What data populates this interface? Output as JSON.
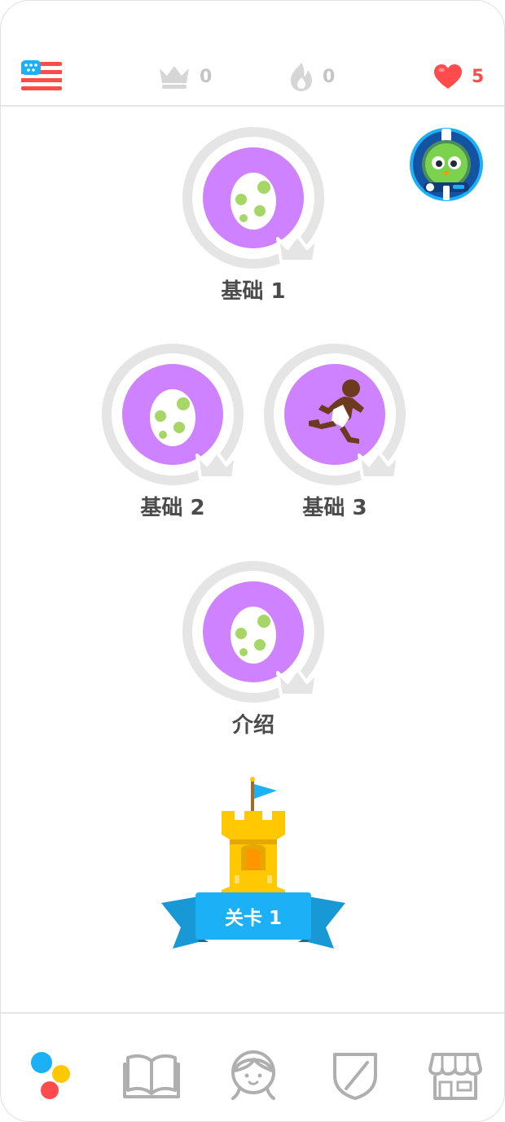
{
  "header": {
    "flag_icon": "us-flag-icon",
    "crowns": "0",
    "streak": "0",
    "hearts": "5"
  },
  "skills": [
    {
      "label": "基础 1",
      "icon": "egg-icon"
    },
    {
      "label": "基础 2",
      "icon": "egg-icon"
    },
    {
      "label": "基础 3",
      "icon": "running-man-icon"
    },
    {
      "label": "介绍",
      "icon": "egg-icon"
    }
  ],
  "checkpoint": {
    "label": "关卡 1"
  },
  "colors": {
    "skill_purple": "#ce82ff",
    "ring_gray": "#e5e5e5",
    "heart_red": "#ff4b4b",
    "castle_gold": "#ffc800",
    "ribbon_blue": "#1cb0f6"
  },
  "nav": [
    "learn-icon",
    "stories-icon",
    "profile-icon",
    "leagues-icon",
    "shop-icon"
  ]
}
